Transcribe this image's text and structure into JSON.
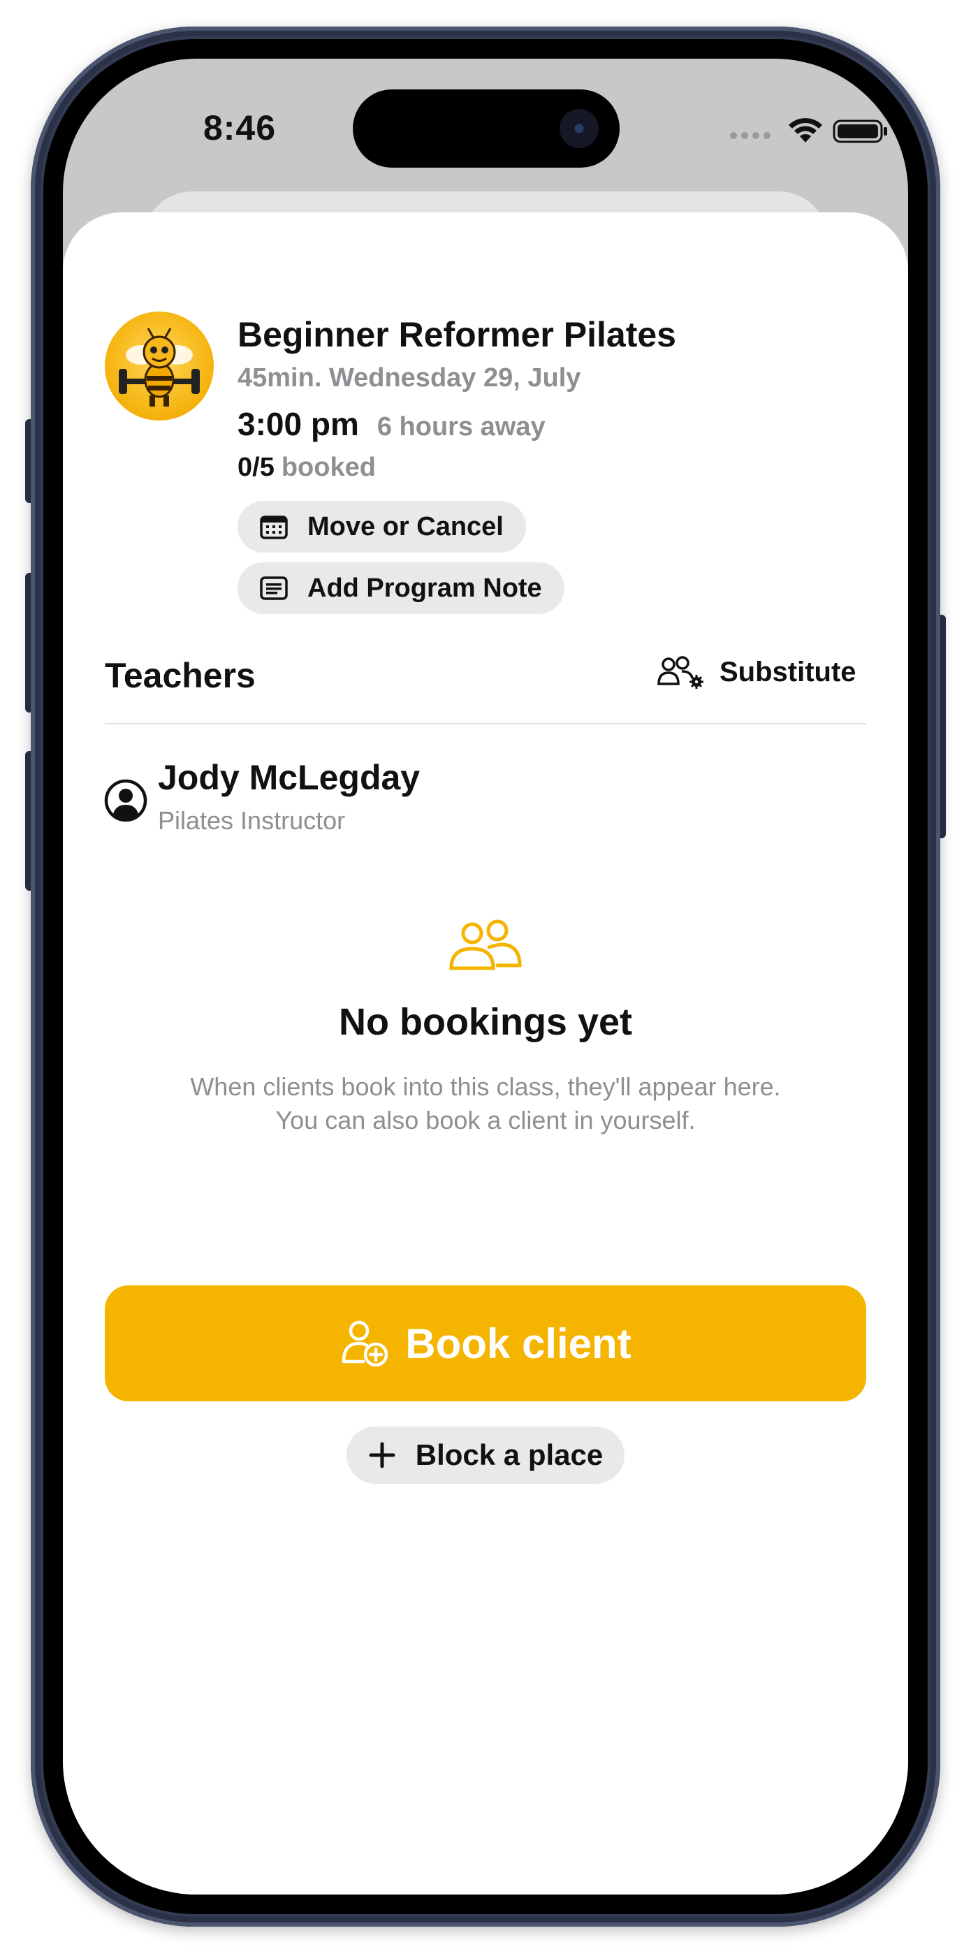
{
  "status_bar": {
    "time": "8:46"
  },
  "class": {
    "title": "Beginner Reformer Pilates",
    "meta": "45min. Wednesday 29, July",
    "time": "3:00 pm",
    "away": "6 hours away",
    "booked_count": "0/5",
    "booked_label": "booked"
  },
  "actions": {
    "move_cancel": "Move or Cancel",
    "program_note": "Add Program Note"
  },
  "teachers": {
    "title": "Teachers",
    "substitute": "Substitute",
    "list": [
      {
        "name": "Jody McLegday",
        "role": "Pilates Instructor"
      }
    ]
  },
  "empty_state": {
    "title": "No bookings yet",
    "line1": "When clients book into this class, they'll appear here.",
    "line2": "You can also book a client in yourself."
  },
  "buttons": {
    "book_client": "Book client",
    "block_place": "Block a place"
  },
  "colors": {
    "accent": "#F4B400",
    "pill_bg": "#E9E9EB",
    "muted_text": "#8E8E93"
  },
  "icons": [
    "calendar-icon",
    "note-icon",
    "substitute-icon",
    "person-circle-icon",
    "people-icon",
    "add-person-icon",
    "plus-icon",
    "wifi-icon",
    "battery-icon",
    "signal-icon"
  ]
}
